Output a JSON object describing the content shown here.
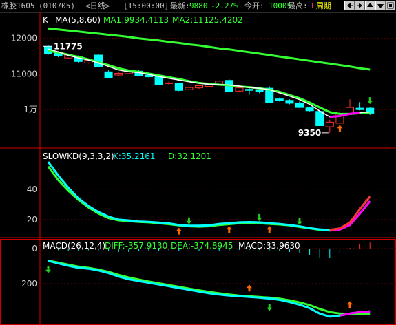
{
  "header": {
    "instrument": "橡胶1605",
    "code": "(010705)",
    "period_tag": "<日线>",
    "time": "[15:00:00]",
    "latest_label": "最新:",
    "latest_value": "9880",
    "change": "-2.27%",
    "open_label": "今开:",
    "open_value": "10005",
    "high_label": "最高:",
    "high_value": "1",
    "cycle_label": "周期"
  },
  "toolbar": {
    "icons": [
      "arrow-left-box-icon",
      "arrow-right-box-icon",
      "arrow-up-box-icon",
      "arrow-down-box-icon",
      "window-box-icon"
    ]
  },
  "colors": {
    "up": "#ff3030",
    "down": "#00ffff",
    "ma_short": "#ffffff",
    "ma_mid": "#33ff33",
    "ma_long": "#33ff33",
    "k_line": "#00ffff",
    "d_line": "#33ff33",
    "accent_frame": "#d00000",
    "grid": "#5a0000",
    "arrow_up": "#ff6600",
    "arrow_down": "#22cc22",
    "magenta": "#ff00ff"
  },
  "chart_data": [
    {
      "type": "candlestick",
      "title": "K",
      "ma_header": "MA(5,8,60)",
      "ma1": "MA1:9934.4113",
      "ma2": "MA2:11125.4202",
      "yticks": [
        "12000",
        "11000",
        "1万"
      ],
      "ytick_values": [
        12000,
        11000,
        10000
      ],
      "ylim": [
        9000,
        12650
      ],
      "high_annotation": "11775",
      "low_annotation": "9350",
      "candles": [
        {
          "o": 11775,
          "c": 11560,
          "h": 11800,
          "l": 11540
        },
        {
          "o": 11600,
          "c": 11500,
          "h": 11640,
          "l": 11470
        },
        {
          "o": 11450,
          "c": 11530,
          "h": 11560,
          "l": 11420
        },
        {
          "o": 11480,
          "c": 11350,
          "h": 11520,
          "l": 11300
        },
        {
          "o": 11310,
          "c": 11380,
          "h": 11420,
          "l": 11290
        },
        {
          "o": 11530,
          "c": 11200,
          "h": 11550,
          "l": 11180
        },
        {
          "o": 11060,
          "c": 10900,
          "h": 11100,
          "l": 10880
        },
        {
          "o": 10970,
          "c": 11020,
          "h": 11050,
          "l": 10950
        },
        {
          "o": 11010,
          "c": 11070,
          "h": 11090,
          "l": 10990
        },
        {
          "o": 11080,
          "c": 10960,
          "h": 11110,
          "l": 10930
        },
        {
          "o": 10970,
          "c": 10920,
          "h": 11000,
          "l": 10900
        },
        {
          "o": 10950,
          "c": 10700,
          "h": 10980,
          "l": 10680
        },
        {
          "o": 10740,
          "c": 10750,
          "h": 10800,
          "l": 10700
        },
        {
          "o": 10740,
          "c": 10540,
          "h": 10760,
          "l": 10520
        },
        {
          "o": 10560,
          "c": 10620,
          "h": 10640,
          "l": 10530
        },
        {
          "o": 10610,
          "c": 10670,
          "h": 10690,
          "l": 10580
        },
        {
          "o": 10650,
          "c": 10720,
          "h": 10740,
          "l": 10620
        },
        {
          "o": 10700,
          "c": 10800,
          "h": 10820,
          "l": 10690
        },
        {
          "o": 10820,
          "c": 10500,
          "h": 10850,
          "l": 10480
        },
        {
          "o": 10520,
          "c": 10610,
          "h": 10640,
          "l": 10500
        },
        {
          "o": 10570,
          "c": 10540,
          "h": 10600,
          "l": 10420
        },
        {
          "o": 10560,
          "c": 10500,
          "h": 10590,
          "l": 10460
        },
        {
          "o": 10600,
          "c": 10200,
          "h": 10650,
          "l": 10180
        },
        {
          "o": 10300,
          "c": 10260,
          "h": 10340,
          "l": 10230
        },
        {
          "o": 10260,
          "c": 10180,
          "h": 10290,
          "l": 10150
        },
        {
          "o": 10190,
          "c": 10060,
          "h": 10230,
          "l": 10040
        },
        {
          "o": 10050,
          "c": 9970,
          "h": 10070,
          "l": 9950
        },
        {
          "o": 9950,
          "c": 9550,
          "h": 9980,
          "l": 9540
        },
        {
          "o": 9520,
          "c": 9650,
          "h": 9720,
          "l": 9350
        },
        {
          "o": 9620,
          "c": 9890,
          "h": 10090,
          "l": 9600
        },
        {
          "o": 9900,
          "c": 10060,
          "h": 10290,
          "l": 9880
        },
        {
          "o": 10040,
          "c": 10000,
          "h": 10210,
          "l": 9980
        },
        {
          "o": 10040,
          "c": 9900,
          "h": 10080,
          "l": 9850
        }
      ],
      "ma_short": [
        11700,
        11620,
        11520,
        11450,
        11390,
        11310,
        11210,
        11110,
        11060,
        11040,
        10990,
        10930,
        10880,
        10830,
        10780,
        10740,
        10710,
        10700,
        10690,
        10660,
        10620,
        10600,
        10560,
        10470,
        10380,
        10280,
        10150,
        9960,
        9800,
        9820,
        9880,
        9920,
        9934
      ],
      "ma_mid": [
        11650,
        11600,
        11540,
        11480,
        11410,
        11330,
        11250,
        11160,
        11100,
        11060,
        11010,
        10960,
        10910,
        10860,
        10800,
        10750,
        10720,
        10700,
        10680,
        10650,
        10630,
        10600,
        10560,
        10500,
        10410,
        10320,
        10200,
        10060,
        9930,
        9880,
        9880,
        9900,
        9920
      ],
      "ma_long": [
        12280,
        12250,
        12220,
        12190,
        12160,
        12130,
        12100,
        12070,
        12040,
        12000,
        11970,
        11940,
        11900,
        11870,
        11830,
        11800,
        11760,
        11720,
        11690,
        11650,
        11610,
        11570,
        11530,
        11490,
        11450,
        11410,
        11370,
        11330,
        11290,
        11250,
        11210,
        11160,
        11125
      ]
    },
    {
      "type": "line",
      "title": "SLOWKD(9,3,3,2)",
      "k_label": "K:35.2161",
      "d_label": "D:32.1201",
      "yticks": [
        "40",
        "20"
      ],
      "ytick_values": [
        40,
        20
      ],
      "ylim": [
        10,
        63
      ],
      "series": [
        {
          "values": [
            58,
            49,
            41,
            34,
            29,
            25,
            22,
            20,
            19.5,
            18.8,
            18.5,
            18,
            17.5,
            16.5,
            16,
            16,
            16.2,
            17.2,
            17.6,
            18.2,
            18.4,
            18.2,
            17.6,
            17.2,
            16.5,
            15.6,
            14.4,
            13.6,
            13.2,
            14.2,
            18,
            27,
            35.2
          ]
        },
        {
          "values": [
            55,
            46,
            39,
            33,
            28,
            24,
            21,
            19.5,
            19,
            18.5,
            18.2,
            17.6,
            17,
            16.2,
            15.6,
            15.4,
            15.6,
            16.5,
            17,
            17.6,
            17.8,
            17.6,
            17.2,
            16.8,
            16.2,
            15.2,
            14.2,
            13.3,
            12.8,
            13.5,
            16.5,
            24,
            32.1
          ]
        }
      ],
      "markers": [
        {
          "i": 13,
          "dir": "up"
        },
        {
          "i": 14,
          "dir": "down"
        },
        {
          "i": 18,
          "dir": "up"
        },
        {
          "i": 21,
          "dir": "down"
        },
        {
          "i": 22,
          "dir": "up"
        },
        {
          "i": 25,
          "dir": "down"
        }
      ]
    },
    {
      "type": "line",
      "title": "MACD(26,12,4)",
      "diff_label": "DIFF:-357.9130",
      "dea_label": "DEA:-374.8945",
      "macd_label": "MACD:33.9630",
      "yticks": [
        "0",
        "-200"
      ],
      "ytick_values": [
        0,
        -200
      ],
      "ylim": [
        -420,
        35
      ],
      "diff": [
        -70,
        -85,
        -98,
        -110,
        -115,
        -125,
        -140,
        -160,
        -175,
        -185,
        -195,
        -205,
        -215,
        -225,
        -235,
        -245,
        -255,
        -262,
        -268,
        -272,
        -276,
        -280,
        -285,
        -292,
        -305,
        -320,
        -340,
        -370,
        -388,
        -382,
        -370,
        -362,
        -358
      ],
      "dea": [
        -68,
        -80,
        -92,
        -103,
        -110,
        -120,
        -133,
        -150,
        -165,
        -177,
        -188,
        -198,
        -208,
        -218,
        -228,
        -238,
        -247,
        -255,
        -262,
        -268,
        -272,
        -276,
        -280,
        -286,
        -295,
        -307,
        -322,
        -344,
        -362,
        -370,
        -372,
        -374,
        -375
      ],
      "macd_hist": [
        -4,
        -10,
        -12,
        -14,
        -10,
        -10,
        -14,
        -20,
        -20,
        -16,
        -14,
        -14,
        -14,
        -14,
        -14,
        -14,
        -16,
        -14,
        -12,
        -8,
        -8,
        -8,
        -10,
        -12,
        -20,
        -26,
        -36,
        -52,
        -52,
        -24,
        4,
        24,
        34
      ],
      "markers": [
        {
          "i": 0,
          "dir": "down"
        },
        {
          "i": 20,
          "dir": "up"
        },
        {
          "i": 22,
          "dir": "down"
        },
        {
          "i": 30,
          "dir": "up"
        }
      ]
    }
  ]
}
